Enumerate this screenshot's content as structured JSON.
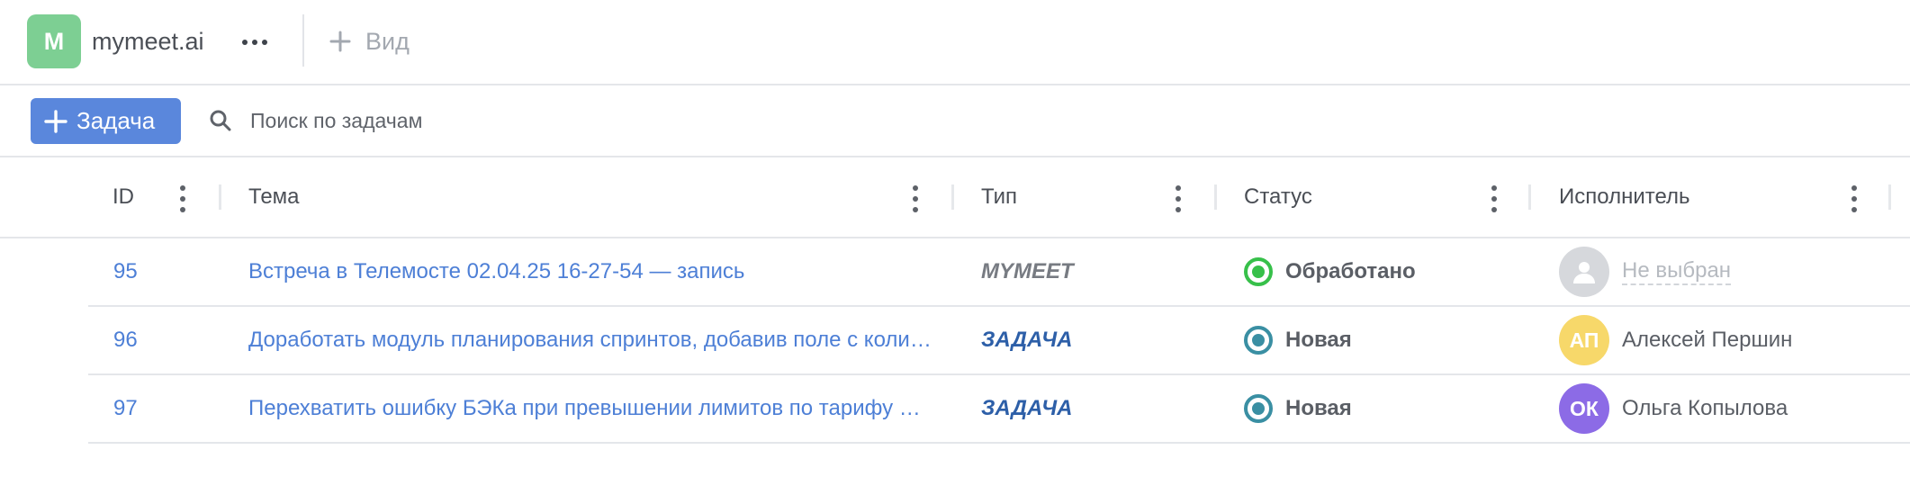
{
  "workspace": {
    "initial": "M",
    "name": "mymeet.ai",
    "badge_color": "#7dcf93"
  },
  "topbar": {
    "add_view_label": "Вид"
  },
  "toolbar": {
    "new_task_label": "Задача",
    "search_placeholder": "Поиск по задачам",
    "accent": "#5a87dc"
  },
  "table": {
    "columns": [
      {
        "key": "id",
        "label": "ID"
      },
      {
        "key": "subject",
        "label": "Тема"
      },
      {
        "key": "type",
        "label": "Тип"
      },
      {
        "key": "status",
        "label": "Статус"
      },
      {
        "key": "assignee",
        "label": "Исполнитель"
      }
    ],
    "rows": [
      {
        "id": "95",
        "subject": "Встреча в Телемосте 02.04.25 16-27-54 — запись",
        "type": "MYMEET",
        "type_color": "#777b82",
        "status": "Обработано",
        "status_color": "#37c04a",
        "status_icon": "check-circle-icon",
        "assignee": "Не выбран",
        "assignee_initials": "",
        "avatar_color": "#d6d8dc",
        "assigned": false
      },
      {
        "id": "96",
        "subject": "Доработать модуль планирования спринтов, добавив поле с количеством задач и отображением прогресса",
        "type": "ЗАДАЧА",
        "type_color": "#2d5fa8",
        "status": "Новая",
        "status_color": "#3a8fa3",
        "status_icon": "radio-circle-icon",
        "assignee": "Алексей Першин",
        "assignee_initials": "АП",
        "avatar_color": "#f7d86a",
        "assigned": true
      },
      {
        "id": "97",
        "subject": "Перехватить ошибку БЭКа при превышении лимитов по тарифу и показать уведомление",
        "type": "ЗАДАЧА",
        "type_color": "#2d5fa8",
        "status": "Новая",
        "status_color": "#3a8fa3",
        "status_icon": "radio-circle-icon",
        "assignee": "Ольга Копылова",
        "assignee_initials": "ОК",
        "avatar_color": "#8c6be6",
        "assigned": true
      }
    ]
  }
}
